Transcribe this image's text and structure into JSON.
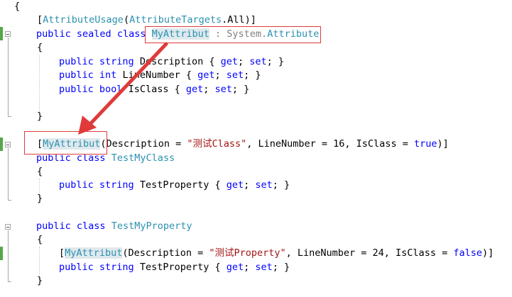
{
  "editor": {
    "lines": [
      {
        "id": "l1",
        "segments": [
          {
            "t": "{",
            "c": "plain"
          }
        ]
      },
      {
        "id": "l2",
        "segments": [
          {
            "t": "[",
            "c": "plain"
          },
          {
            "t": "AttributeUsage",
            "c": "type"
          },
          {
            "t": "(",
            "c": "plain"
          },
          {
            "t": "AttributeTargets",
            "c": "type"
          },
          {
            "t": ".All)]",
            "c": "plain"
          }
        ]
      },
      {
        "id": "l3",
        "segments": [
          {
            "t": "public",
            "c": "kw"
          },
          {
            "t": " ",
            "c": "plain"
          },
          {
            "t": "sealed",
            "c": "kw"
          },
          {
            "t": " ",
            "c": "plain"
          },
          {
            "t": "class",
            "c": "kw"
          },
          {
            "t": " ",
            "c": "plain"
          },
          {
            "t": "MyAttribut",
            "c": "type-hl"
          },
          {
            "t": " : System.",
            "c": "plain-gray"
          },
          {
            "t": "Attribute",
            "c": "type"
          }
        ]
      },
      {
        "id": "l4",
        "segments": [
          {
            "t": "{",
            "c": "plain"
          }
        ]
      },
      {
        "id": "l5",
        "segments": [
          {
            "t": "public",
            "c": "kw"
          },
          {
            "t": " ",
            "c": "plain"
          },
          {
            "t": "string",
            "c": "kw"
          },
          {
            "t": " Description { ",
            "c": "plain"
          },
          {
            "t": "get",
            "c": "kw"
          },
          {
            "t": "; ",
            "c": "plain"
          },
          {
            "t": "set",
            "c": "kw"
          },
          {
            "t": "; }",
            "c": "plain"
          }
        ]
      },
      {
        "id": "l6",
        "segments": [
          {
            "t": "public",
            "c": "kw"
          },
          {
            "t": " ",
            "c": "plain"
          },
          {
            "t": "int",
            "c": "kw"
          },
          {
            "t": " LineNumber { ",
            "c": "plain"
          },
          {
            "t": "get",
            "c": "kw"
          },
          {
            "t": "; ",
            "c": "plain"
          },
          {
            "t": "set",
            "c": "kw"
          },
          {
            "t": "; }",
            "c": "plain"
          }
        ]
      },
      {
        "id": "l7",
        "segments": [
          {
            "t": "public",
            "c": "kw"
          },
          {
            "t": " ",
            "c": "plain"
          },
          {
            "t": "bool",
            "c": "kw"
          },
          {
            "t": " IsClass { ",
            "c": "plain"
          },
          {
            "t": "get",
            "c": "kw"
          },
          {
            "t": "; ",
            "c": "plain"
          },
          {
            "t": "set",
            "c": "kw"
          },
          {
            "t": "; }",
            "c": "plain"
          }
        ]
      },
      {
        "id": "l8",
        "segments": [
          {
            "t": "",
            "c": "plain"
          }
        ]
      },
      {
        "id": "l9",
        "segments": [
          {
            "t": "}",
            "c": "plain"
          }
        ]
      },
      {
        "id": "l10",
        "segments": [
          {
            "t": "",
            "c": "plain"
          }
        ]
      },
      {
        "id": "l11",
        "segments": [
          {
            "t": "[",
            "c": "plain"
          },
          {
            "t": "MyAttribut",
            "c": "type-hl"
          },
          {
            "t": "(Description = ",
            "c": "plain"
          },
          {
            "t": "\"测试Class\"",
            "c": "str"
          },
          {
            "t": ", LineNumber = 16, IsClass = ",
            "c": "plain"
          },
          {
            "t": "true",
            "c": "kw"
          },
          {
            "t": ")]",
            "c": "plain"
          }
        ]
      },
      {
        "id": "l12",
        "segments": [
          {
            "t": "public",
            "c": "kw"
          },
          {
            "t": " ",
            "c": "plain"
          },
          {
            "t": "class",
            "c": "kw"
          },
          {
            "t": " ",
            "c": "plain"
          },
          {
            "t": "TestMyClass",
            "c": "type"
          }
        ]
      },
      {
        "id": "l13",
        "segments": [
          {
            "t": "{",
            "c": "plain"
          }
        ]
      },
      {
        "id": "l14",
        "segments": [
          {
            "t": "public",
            "c": "kw"
          },
          {
            "t": " ",
            "c": "plain"
          },
          {
            "t": "string",
            "c": "kw"
          },
          {
            "t": " TestProperty { ",
            "c": "plain"
          },
          {
            "t": "get",
            "c": "kw"
          },
          {
            "t": "; ",
            "c": "plain"
          },
          {
            "t": "set",
            "c": "kw"
          },
          {
            "t": "; }",
            "c": "plain"
          }
        ]
      },
      {
        "id": "l15",
        "segments": [
          {
            "t": "}",
            "c": "plain"
          }
        ]
      },
      {
        "id": "l16",
        "segments": [
          {
            "t": "",
            "c": "plain"
          }
        ]
      },
      {
        "id": "l17",
        "segments": [
          {
            "t": "public",
            "c": "kw"
          },
          {
            "t": " ",
            "c": "plain"
          },
          {
            "t": "class",
            "c": "kw"
          },
          {
            "t": " ",
            "c": "plain"
          },
          {
            "t": "TestMyProperty",
            "c": "type"
          }
        ]
      },
      {
        "id": "l18",
        "segments": [
          {
            "t": "{",
            "c": "plain"
          }
        ]
      },
      {
        "id": "l19",
        "segments": [
          {
            "t": "[",
            "c": "plain"
          },
          {
            "t": "MyAttribut",
            "c": "type-hl"
          },
          {
            "t": "(Description = ",
            "c": "plain"
          },
          {
            "t": "\"测试Property\"",
            "c": "str"
          },
          {
            "t": ", LineNumber = 24, IsClass = ",
            "c": "plain"
          },
          {
            "t": "false",
            "c": "kw"
          },
          {
            "t": ")]",
            "c": "plain"
          }
        ]
      },
      {
        "id": "l20",
        "segments": [
          {
            "t": "public",
            "c": "kw"
          },
          {
            "t": " ",
            "c": "plain"
          },
          {
            "t": "string",
            "c": "kw"
          },
          {
            "t": " TestProperty { ",
            "c": "plain"
          },
          {
            "t": "get",
            "c": "kw"
          },
          {
            "t": "; ",
            "c": "plain"
          },
          {
            "t": "set",
            "c": "kw"
          },
          {
            "t": "; }",
            "c": "plain"
          }
        ]
      },
      {
        "id": "l21",
        "segments": [
          {
            "t": "}",
            "c": "plain"
          }
        ]
      }
    ]
  },
  "colors": {
    "keyword": "#0000ff",
    "type": "#2b91af",
    "string": "#a31515",
    "annotation": "#e03a3a",
    "change_marker": "#57a64a",
    "highlight": "#dfe9ed"
  }
}
